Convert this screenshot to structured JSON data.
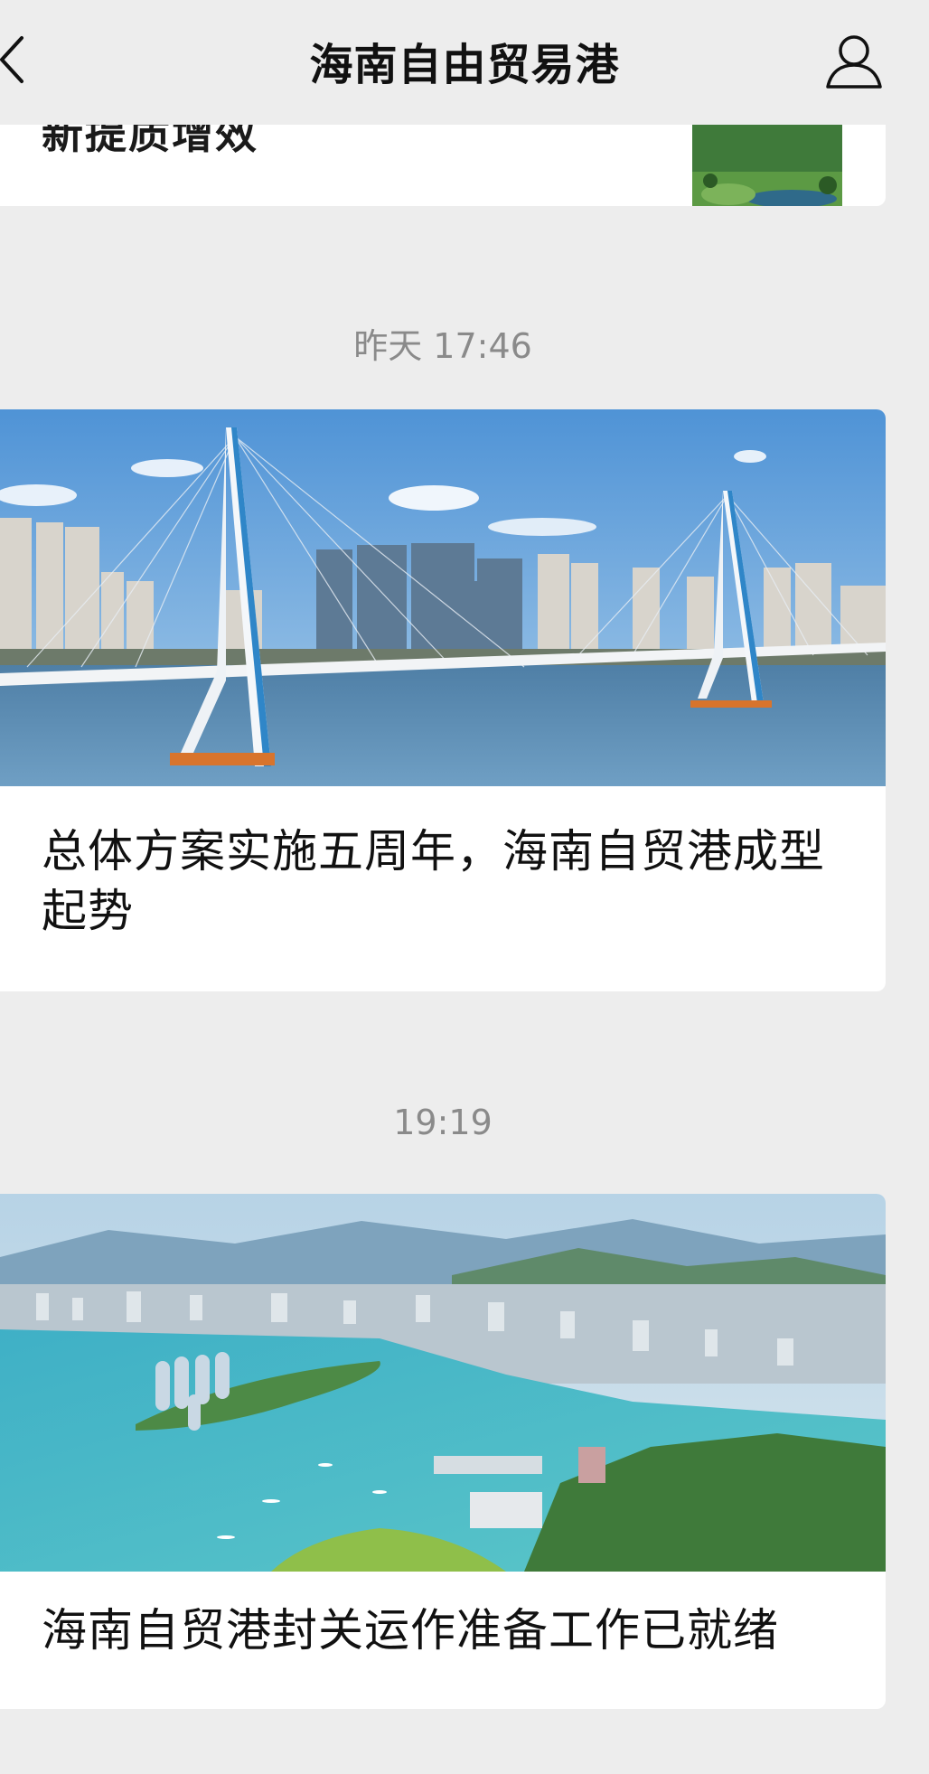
{
  "header": {
    "title": "海南自由贸易港",
    "back_icon": "chevron-left-icon",
    "profile_icon": "person-icon"
  },
  "previous_article": {
    "title_fragment": "新提质增效"
  },
  "messages": [
    {
      "timestamp": "昨天 17:46",
      "title": "总体方案实施五周年，海南自贸港成型起势"
    },
    {
      "timestamp": "19:19",
      "title": "海南自贸港封关运作准备工作已就绪"
    }
  ],
  "colors": {
    "background": "#ededed",
    "card": "#ffffff",
    "timestamp": "#8a8a8a",
    "title": "#111111"
  }
}
